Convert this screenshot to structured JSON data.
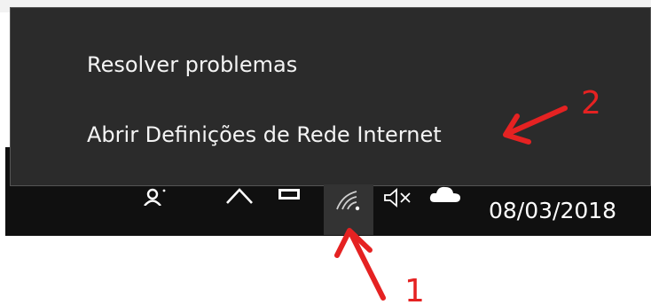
{
  "menu": {
    "items": [
      {
        "label": "Resolver problemas"
      },
      {
        "label": "Abrir Definições de Rede  Internet"
      }
    ]
  },
  "taskbar": {
    "date": "08/03/2018",
    "icons": [
      "person-icon",
      "chevron-up-icon",
      "window-icon",
      "wifi-icon",
      "volume-muted-icon",
      "cloud-icon"
    ]
  },
  "annotations": {
    "arrow_1_label": "1",
    "arrow_2_label": "2",
    "color": "#e52222"
  },
  "colors": {
    "menu_bg": "#2b2b2b",
    "taskbar_bg": "#101010",
    "highlight_bg": "#333333"
  }
}
